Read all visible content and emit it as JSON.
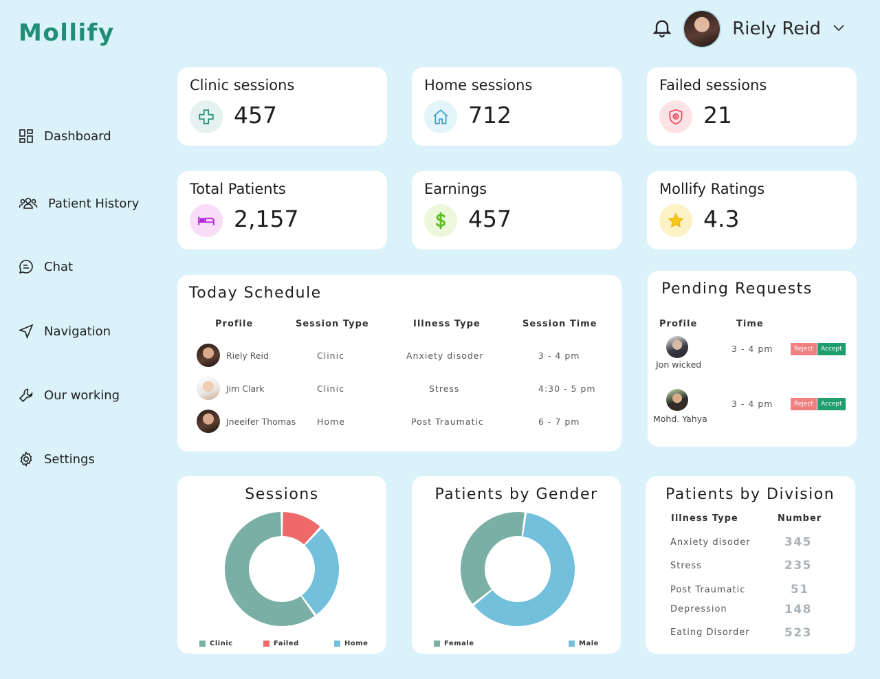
{
  "app": {
    "logo": "Mollify"
  },
  "user": {
    "name": "Riely Reid"
  },
  "sidebar": {
    "items": [
      {
        "label": "Dashboard",
        "icon": "dashboard-icon"
      },
      {
        "label": "Patient History",
        "icon": "users-icon"
      },
      {
        "label": "Chat",
        "icon": "chat-icon"
      },
      {
        "label": "Navigation",
        "icon": "navigation-icon"
      },
      {
        "label": "Our working",
        "icon": "wrench-icon"
      },
      {
        "label": "Settings",
        "icon": "gear-icon"
      }
    ]
  },
  "stats": [
    {
      "title": "Clinic sessions",
      "value": "457",
      "icon": "plus-icon",
      "color": "#1f8e74",
      "bg": "#e6f2ef"
    },
    {
      "title": "Home sessions",
      "value": "712",
      "icon": "home-icon",
      "color": "#3aa0c4",
      "bg": "#e3f4fa"
    },
    {
      "title": "Failed sessions",
      "value": "21",
      "icon": "shield-icon",
      "color": "#e84b5c",
      "bg": "#fde3e6"
    },
    {
      "title": "Total Patients",
      "value": "2,157",
      "icon": "bed-icon",
      "color": "#b02bd8",
      "bg": "#f8dcf8"
    },
    {
      "title": "Earnings",
      "value": "457",
      "icon": "dollar-icon",
      "color": "#5bbd1f",
      "bg": "#edf7dc"
    },
    {
      "title": "Mollify Ratings",
      "value": "4.3",
      "icon": "star-icon",
      "color": "#f5c518",
      "bg": "#fdf2c6"
    }
  ],
  "schedule": {
    "title": "Today Schedule",
    "headers": [
      "Profile",
      "Session Type",
      "Illness Type",
      "Session Time"
    ],
    "rows": [
      {
        "name": "Riely Reid",
        "session_type": "Clinic",
        "illness": "Anxiety disoder",
        "time": "3 - 4 pm"
      },
      {
        "name": "Jim Clark",
        "session_type": "Clinic",
        "illness": "Stress",
        "time": "4:30 - 5 pm"
      },
      {
        "name": "Jneeifer Thomas",
        "session_type": "Home",
        "illness": "Post Traumatic",
        "time": "6 - 7 pm"
      }
    ]
  },
  "pending": {
    "title": "Pending Requests",
    "headers": [
      "Profile",
      "Time"
    ],
    "reject_label": "Reject",
    "accept_label": "Accept",
    "rows": [
      {
        "name": "Jon wicked",
        "time": "3 - 4 pm"
      },
      {
        "name": "Mohd. Yahya",
        "time": "3 - 4 pm"
      }
    ]
  },
  "charts": {
    "sessions_title": "Sessions",
    "gender_title": "Patients by Gender"
  },
  "chart_data": [
    {
      "type": "pie",
      "title": "Sessions",
      "categories": [
        "Clinic",
        "Failed",
        "Home"
      ],
      "values": [
        60,
        12,
        28
      ],
      "colors": [
        "#7aafa5",
        "#ee6a6a",
        "#72c0dc"
      ]
    },
    {
      "type": "pie",
      "title": "Patients by Gender",
      "categories": [
        "Female",
        "Male"
      ],
      "values": [
        38,
        62
      ],
      "colors": [
        "#7aafa5",
        "#72c0dc"
      ]
    }
  ],
  "division": {
    "title": "Patients by Division",
    "headers": [
      "Illness Type",
      "Number"
    ],
    "rows": [
      {
        "type": "Anxiety disoder",
        "number": "345"
      },
      {
        "type": "Stress",
        "number": "235"
      },
      {
        "type": "Post Traumatic",
        "number": "51"
      },
      {
        "type": "Depression",
        "number": "148"
      },
      {
        "type": "Eating Disorder",
        "number": "523"
      }
    ]
  }
}
